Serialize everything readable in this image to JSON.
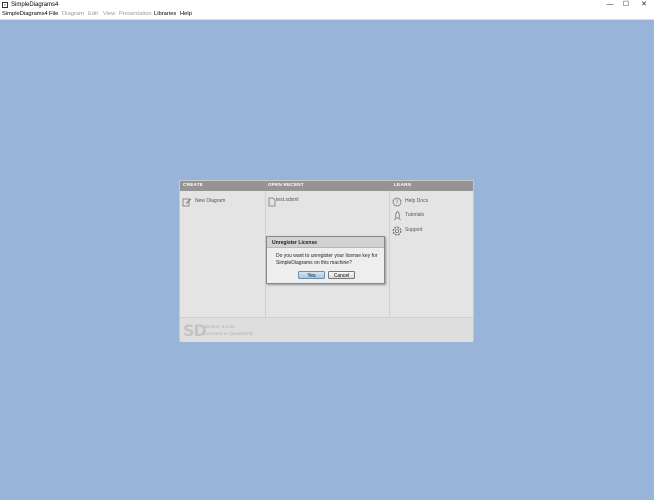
{
  "window": {
    "title": "SimpleDiagrams4",
    "controls": {
      "minimize": "—",
      "maximize": "☐",
      "close": "✕"
    }
  },
  "menu": {
    "items": [
      {
        "label": "SimpleDiagrams4",
        "enabled": true
      },
      {
        "label": "File",
        "enabled": true
      },
      {
        "label": "Diagram",
        "enabled": false
      },
      {
        "label": "Edit",
        "enabled": false
      },
      {
        "label": "View",
        "enabled": false
      },
      {
        "label": "Presentation",
        "enabled": false
      },
      {
        "label": "Libraries",
        "enabled": true
      },
      {
        "label": "Help",
        "enabled": true
      }
    ]
  },
  "start_panel": {
    "create": {
      "header": "CREATE",
      "new_diagram": "New Diagram"
    },
    "open_recent": {
      "header": "OPEN RECENT",
      "files": [
        "test.sdxml"
      ]
    },
    "learn": {
      "header": "LEARN",
      "help_docs": "Help Docs",
      "tutorials": "Tutorials",
      "support": "Support"
    },
    "footer": {
      "logo": "SD",
      "version": "Version: 4.0.28",
      "licensed": "Licensed to:  [Board649]"
    }
  },
  "dialog": {
    "title": "Unregister License",
    "message": "Do you want to unregister your license key for SimpleDiagrams on this machine?",
    "yes_label": "Yes",
    "cancel_label": "Cancel"
  },
  "colors": {
    "desktop": "#99b4d9",
    "panel_header": "#949494",
    "panel_body": "#e4e4e4"
  }
}
